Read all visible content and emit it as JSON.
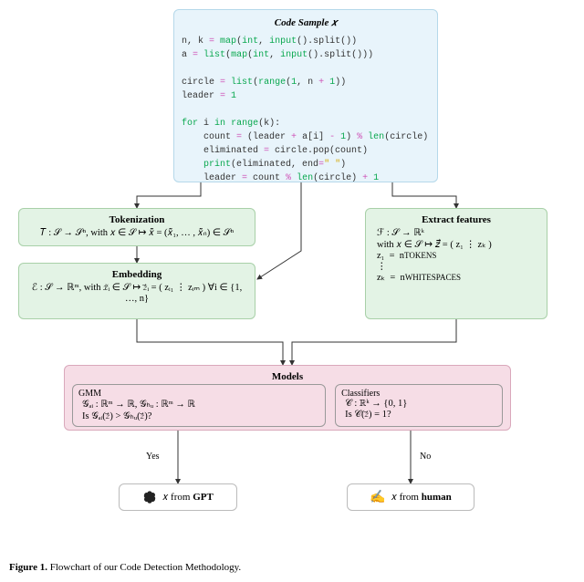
{
  "code_sample": {
    "title": "Code Sample 𝑥",
    "lines": "n, k = map(int, input().split())\na = list(map(int, input().split()))\n\ncircle = list(range(1, n + 1))\nleader = 1\n\nfor i in range(k):\n    count = (leader + a[i] - 1) % len(circle)\n    eliminated = circle.pop(count)\n    print(eliminated, end=\" \")\n    leader = count % len(circle) + 1"
  },
  "tokenization": {
    "title": "Tokenization",
    "formula": "𝑇 : 𝒮 → 𝒮ⁿ, with 𝑥 ∈ 𝒮 ↦ 𝑥̃ = (𝑥̃₁, … , 𝑥̃ₙ) ∈ 𝒮ⁿ"
  },
  "embedding": {
    "title": "Embedding",
    "formula": "ℰ : 𝒮 → ℝᵐ, with 𝑥̃ᵢ ∈ 𝒮 ↦ 𝑧⃗ᵢ = ( zᵢ₁ ⋮ zᵢₘ ) ∀i ∈ {1, …, n}"
  },
  "features": {
    "title": "Extract features",
    "line1": "ℱ : 𝒮 → ℝᵏ",
    "line2": "with 𝑥 ∈ 𝒮 ↦ 𝑧⃗ = ( z₁ ⋮ zₖ )",
    "line3": "z₁  =  nᴛᴏᴋᴇɴs",
    "line4": "       ⋮",
    "line5": "zₖ  =  nᴡʜɪᴛᴇsᴘᴀᴄᴇs"
  },
  "models": {
    "title": "Models",
    "gmm": {
      "title": "GMM",
      "line1": "𝒢ₐᵢ : ℝᵐ → ℝ, 𝒢ₕᵤ : ℝᵐ → ℝ",
      "line2": "Is 𝒢ₐᵢ(𝑧⃗) > 𝒢ₕᵤ(𝑧⃗)?"
    },
    "classifiers": {
      "title": "Classifiers",
      "line1": "𝒞 : ℝᵏ → {0, 1}",
      "line2": "Is 𝒞(𝑧⃗) = 1?"
    }
  },
  "branches": {
    "yes": "Yes",
    "no": "No"
  },
  "outcomes": {
    "gpt": "𝑥 from GPT",
    "human": "𝑥 from human"
  },
  "caption": {
    "label": "Figure 1.",
    "text": "Flowchart of our Code Detection Methodology."
  }
}
